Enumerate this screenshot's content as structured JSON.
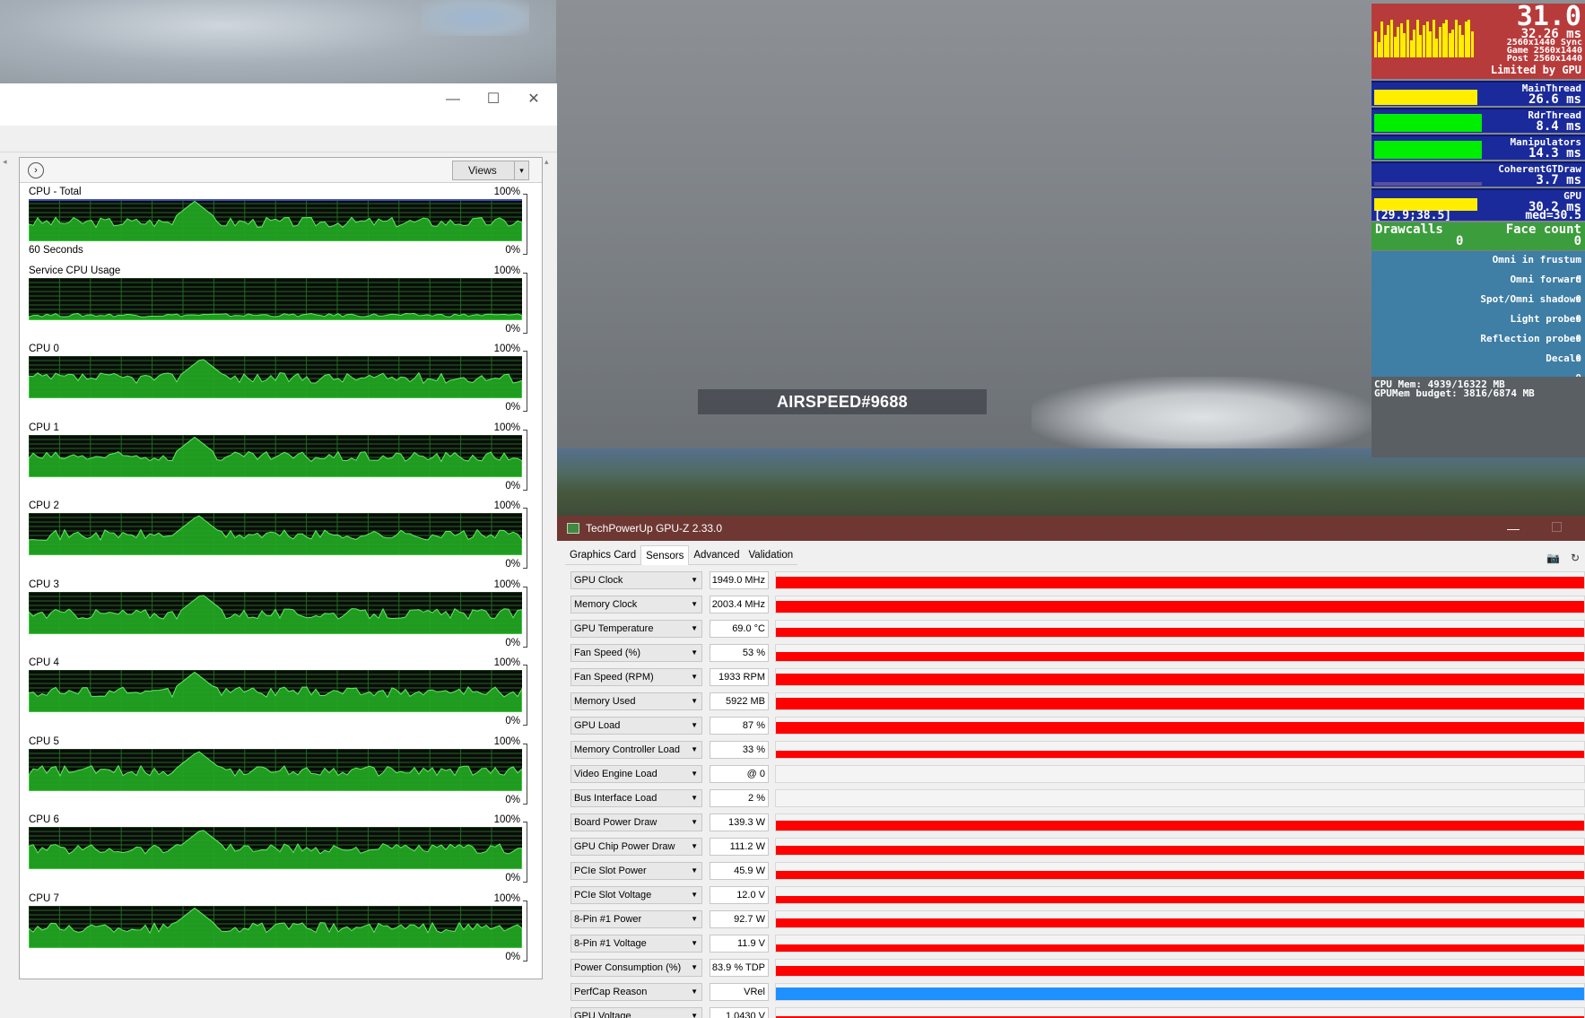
{
  "game": {
    "player_tag": "AIRSPEED#9688"
  },
  "fps_overlay": {
    "fps": "31.0",
    "frame_ms": "32.26 ms",
    "res_lines": [
      "2560x1440 Sync",
      "Game 2560x1440",
      "Post 2560x1440"
    ],
    "limited_by": "Limited by GPU",
    "blocks": [
      {
        "label": "MainThread",
        "value": "26.6 ms",
        "bar_color": "#ffee00"
      },
      {
        "label": "RdrThread",
        "value": "8.4 ms",
        "bar_color": "#00ee00"
      },
      {
        "label": "Manipulators",
        "value": "14.3 ms",
        "bar_color": "#00ee00"
      },
      {
        "label": "CoherentGTDraw",
        "value": "3.7 ms",
        "bar_color": "#5a4fa0"
      }
    ],
    "gpu": {
      "label": "GPU",
      "value": "30.2 ms",
      "range": "[29.9;38.5]",
      "med": "med=30.5"
    },
    "drawcalls": {
      "label1": "Drawcalls",
      "label2": "Face count",
      "value1": "0",
      "value2": "0"
    },
    "probes": [
      {
        "label": "Omni in frustum",
        "value": "0"
      },
      {
        "label": "Omni forward",
        "value": "0"
      },
      {
        "label": "Spot/Omni shadows",
        "value": "0"
      },
      {
        "label": "Light probes",
        "value": "0"
      },
      {
        "label": "Reflection probes",
        "value": "0"
      },
      {
        "label": "Decals",
        "value": "0"
      }
    ],
    "cpu_mem": "CPU Mem: 4939/16322 MB",
    "gpu_mem": "GPUMem budget: 3816/6874 MB"
  },
  "perf_window": {
    "minimize_icon": "—",
    "maximize_icon": "☐",
    "close_icon": "✕",
    "expand_icon": "›",
    "views_label": "Views",
    "dropdown_icon": "▾",
    "graphs": [
      {
        "title": "CPU - Total",
        "top": "100%",
        "bottom": "0%",
        "sub": "60 Seconds"
      },
      {
        "title": "Service CPU Usage",
        "top": "100%",
        "bottom": "0%",
        "sub": ""
      },
      {
        "title": "CPU 0",
        "top": "100%",
        "bottom": "0%",
        "sub": ""
      },
      {
        "title": "CPU 1",
        "top": "100%",
        "bottom": "0%",
        "sub": ""
      },
      {
        "title": "CPU 2",
        "top": "100%",
        "bottom": "0%",
        "sub": ""
      },
      {
        "title": "CPU 3",
        "top": "100%",
        "bottom": "0%",
        "sub": ""
      },
      {
        "title": "CPU 4",
        "top": "100%",
        "bottom": "0%",
        "sub": ""
      },
      {
        "title": "CPU 5",
        "top": "100%",
        "bottom": "0%",
        "sub": ""
      },
      {
        "title": "CPU 6",
        "top": "100%",
        "bottom": "0%",
        "sub": ""
      },
      {
        "title": "CPU 7",
        "top": "100%",
        "bottom": "0%",
        "sub": ""
      }
    ]
  },
  "gpuz": {
    "title": "TechPowerUp GPU-Z 2.33.0",
    "minimize_icon": "—",
    "tabs": [
      "Graphics Card",
      "Sensors",
      "Advanced",
      "Validation"
    ],
    "active_tab": "Sensors",
    "camera_icon": "📷",
    "refresh_icon": "↻",
    "sensors": [
      {
        "name": "GPU Clock",
        "value": "1949.0 MHz",
        "level": 0.75,
        "color": "#ff0000"
      },
      {
        "name": "Memory Clock",
        "value": "2003.4 MHz",
        "level": 0.75,
        "color": "#ff0000"
      },
      {
        "name": "GPU Temperature",
        "value": "69.0 °C",
        "level": 0.55,
        "color": "#ff0000"
      },
      {
        "name": "Fan Speed (%)",
        "value": "53 %",
        "level": 0.55,
        "color": "#ff0000"
      },
      {
        "name": "Fan Speed (RPM)",
        "value": "1933 RPM",
        "level": 0.7,
        "color": "#ff0000"
      },
      {
        "name": "Memory Used",
        "value": "5922 MB",
        "level": 0.7,
        "color": "#ff0000"
      },
      {
        "name": "GPU Load",
        "value": "87 %",
        "level": 0.75,
        "color": "#ff0000"
      },
      {
        "name": "Memory Controller Load",
        "value": "33 %",
        "level": 0.45,
        "color": "#ff0000"
      },
      {
        "name": "Video Engine Load",
        "value": "@ 0",
        "level": 0,
        "color": "#ff0000"
      },
      {
        "name": "Bus Interface Load",
        "value": "2 %",
        "level": 0,
        "color": "#ff0000"
      },
      {
        "name": "Board Power Draw",
        "value": "139.3 W",
        "level": 0.6,
        "color": "#ff0000"
      },
      {
        "name": "GPU Chip Power Draw",
        "value": "111.2 W",
        "level": 0.55,
        "color": "#ff0000"
      },
      {
        "name": "PCIe Slot Power",
        "value": "45.9 W",
        "level": 0.5,
        "color": "#ff0000"
      },
      {
        "name": "PCIe Slot Voltage",
        "value": "12.0 V",
        "level": 0.45,
        "color": "#ff0000"
      },
      {
        "name": "8-Pin #1 Power",
        "value": "92.7 W",
        "level": 0.55,
        "color": "#ff0000"
      },
      {
        "name": "8-Pin #1 Voltage",
        "value": "11.9 V",
        "level": 0.45,
        "color": "#ff0000"
      },
      {
        "name": "Power Consumption (%)",
        "value": "83.9 % TDP",
        "level": 0.6,
        "color": "#ff0000"
      },
      {
        "name": "PerfCap Reason",
        "value": "VRel",
        "level": 0.8,
        "color": "#1e90ff"
      },
      {
        "name": "GPU Voltage",
        "value": "1.0430 V",
        "level": 0.5,
        "color": "#ff0000"
      }
    ]
  }
}
